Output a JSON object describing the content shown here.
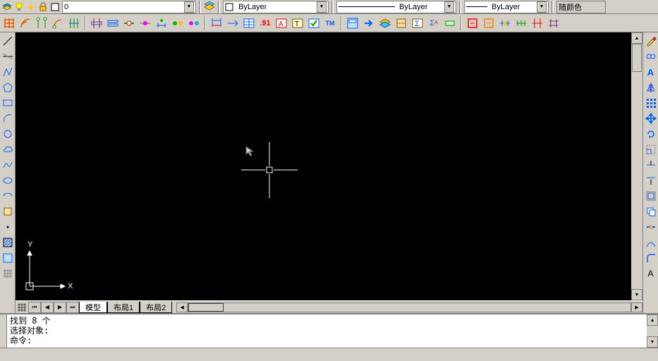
{
  "props_bar": {
    "layer_dropdown_text": "0",
    "linetype_text": "ByLayer",
    "lineweight_text": "ByLayer",
    "plotstyle_text": "ByLayer",
    "color_text": "随颜色"
  },
  "toolbar_rows": [
    [
      "grid-icon",
      "arc-icon",
      "axis-net-icon",
      "arc-axis-icon",
      "grid-col-icon",
      "",
      "beam-icon",
      "beam2-icon",
      "wall-join-icon",
      "dot-join-icon",
      "dim-beam-icon",
      "rebar1-icon",
      "rebar2-icon",
      "",
      "dim-linear-icon",
      "dim-continue-icon",
      "table-icon",
      "dim-text-icon",
      "text-red-icon",
      "text-box-icon",
      "text-check-icon",
      "tm-icon",
      "",
      "window-icon",
      "arrow-right-icon",
      "layer-stack-icon",
      "section-icon",
      "sum-icon",
      "sigma-icon",
      "element-icon",
      "",
      "red-frame-icon",
      "orange-frame-icon",
      "joint-dim-icon",
      "span-dim-icon",
      "col-dim-icon",
      "beam-dim-icon"
    ]
  ],
  "right_tools": [
    "pencil-icon",
    "link-icon",
    "font-icon",
    "mirror-icon",
    "array-icon",
    "move-icon",
    "rotate-icon",
    "scale-icon",
    "trim-icon",
    "extend-icon",
    "offset-icon",
    "copy-icon",
    "break-icon",
    "spline-icon",
    "fillet-icon",
    "text-icon"
  ],
  "left_tools": [
    "line-icon",
    "xline-icon",
    "pline-icon",
    "polygon-icon",
    "rect-icon",
    "arc-cmd-icon",
    "circle-icon",
    "cloud-icon",
    "spline-cmd-icon",
    "ellipse-icon",
    "earc-icon",
    "block-icon",
    "point-icon",
    "hatch-icon",
    "region-icon",
    "bottom-icon"
  ],
  "tabs": {
    "nav": [
      "⏮",
      "◀",
      "▶",
      "⏭"
    ],
    "items": [
      "模型",
      "布局1",
      "布局2"
    ],
    "active": 0
  },
  "ucs": {
    "x_label": "X",
    "y_label": "Y"
  },
  "command_window": {
    "line1": "找到 8 个",
    "line2": "选择对象:",
    "line3": "命令:"
  }
}
